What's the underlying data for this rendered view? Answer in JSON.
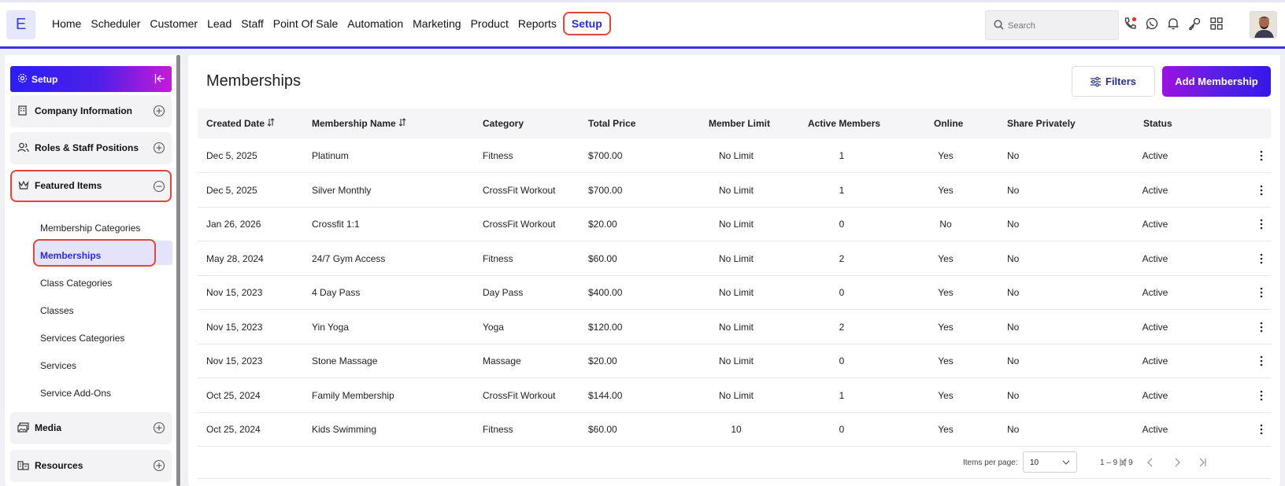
{
  "app": {
    "logo_letter": "E"
  },
  "nav": {
    "items": [
      "Home",
      "Scheduler",
      "Customer",
      "Lead",
      "Staff",
      "Point Of Sale",
      "Automation",
      "Marketing",
      "Product",
      "Reports"
    ],
    "active": "Setup"
  },
  "search": {
    "placeholder": "Search"
  },
  "top_icons": [
    "phone-icon",
    "whatsapp-icon",
    "bell-icon",
    "key-icon",
    "apps-grid-icon"
  ],
  "sidebar": {
    "header": "Setup",
    "sections": [
      {
        "label": "Company Information",
        "icon": "building-icon",
        "expanded": false
      },
      {
        "label": "Roles & Staff Positions",
        "icon": "users-icon",
        "expanded": false
      },
      {
        "label": "Featured Items",
        "icon": "crown-icon",
        "expanded": true
      },
      {
        "label": "Media",
        "icon": "media-icon",
        "expanded": false
      },
      {
        "label": "Resources",
        "icon": "resources-icon",
        "expanded": false
      }
    ],
    "sub_items": [
      "Membership Categories",
      "Memberships",
      "Class Categories",
      "Classes",
      "Services Categories",
      "Services",
      "Service Add-Ons"
    ],
    "active_sub": "Memberships"
  },
  "main": {
    "title": "Memberships",
    "filters_label": "Filters",
    "add_label": "Add Membership"
  },
  "table": {
    "headers": [
      "Created Date",
      "Membership Name",
      "Category",
      "Total Price",
      "Member Limit",
      "Active Members",
      "Online",
      "Share Privately",
      "Status"
    ],
    "rows": [
      [
        "Dec 5, 2025",
        "Platinum",
        "Fitness",
        "$700.00",
        "No Limit",
        "1",
        "Yes",
        "No",
        "Active"
      ],
      [
        "Dec 5, 2025",
        "Silver Monthly",
        "CrossFit Workout",
        "$700.00",
        "No Limit",
        "1",
        "Yes",
        "No",
        "Active"
      ],
      [
        "Jan 26, 2026",
        "Crossfit 1:1",
        "CrossFit Workout",
        "$20.00",
        "No Limit",
        "0",
        "No",
        "No",
        "Active"
      ],
      [
        "May 28, 2024",
        "24/7 Gym Access",
        "Fitness",
        "$60.00",
        "No Limit",
        "2",
        "Yes",
        "No",
        "Active"
      ],
      [
        "Nov 15, 2023",
        "4 Day Pass",
        "Day Pass",
        "$400.00",
        "No Limit",
        "0",
        "Yes",
        "No",
        "Active"
      ],
      [
        "Nov 15, 2023",
        "Yin Yoga",
        "Yoga",
        "$120.00",
        "No Limit",
        "2",
        "Yes",
        "No",
        "Active"
      ],
      [
        "Nov 15, 2023",
        "Stone Massage",
        "Massage",
        "$20.00",
        "No Limit",
        "0",
        "Yes",
        "No",
        "Active"
      ],
      [
        "Oct 25, 2024",
        "Family Membership",
        "CrossFit Workout",
        "$144.00",
        "No Limit",
        "1",
        "Yes",
        "No",
        "Active"
      ],
      [
        "Oct 25, 2024",
        "Kids Swimming",
        "Fitness",
        "$60.00",
        "10",
        "0",
        "Yes",
        "No",
        "Active"
      ]
    ]
  },
  "pagination": {
    "items_per_page_label": "Items per page:",
    "items_per_page": "10",
    "range": "1 – 9 of 9"
  },
  "colors": {
    "accent": "#2a2bd8",
    "highlight": "#e0463a",
    "brand_gradient_start": "#9b12df",
    "brand_gradient_end": "#3617ec"
  }
}
